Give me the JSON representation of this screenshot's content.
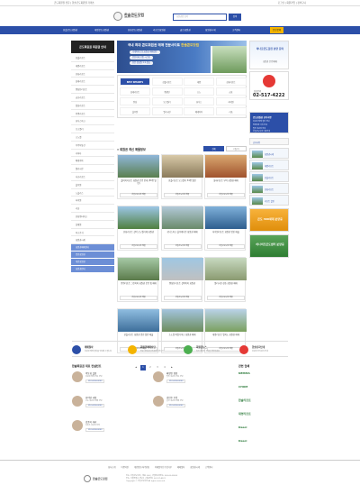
{
  "topbar": {
    "left": "콘도회원권 전문 | 한솔콘도회원권 거래소",
    "right": "로그인 | 회원가입 | 장바구니"
  },
  "header": {
    "logo_title": "한솔콘도닷컴",
    "logo_sub": "HANSOL CONDO",
    "search_placeholder": "회원권명 검색",
    "search_button": "검색"
  },
  "gnb": [
    "한솔콘도회원권",
    "대명콘도회원권",
    "한화콘도회원권",
    "리조트회원권",
    "골프회원권",
    "회원권시세",
    "고객센터"
  ],
  "gnb_highlight": "분양문의",
  "sidebar": {
    "title": "콘도회원권 회원권 안내",
    "items": [
      "한솔리조트",
      "대명리조트",
      "한화리조트",
      "롯데리조트",
      "켄싱턴리조트",
      "금호리조트",
      "일성리조트",
      "용평리조트",
      "휘닉스파크",
      "오크밸리",
      "소노벨",
      "무주덕유산",
      "라마다",
      "베네치아",
      "엘리시안",
      "사조리조트",
      "블루원",
      "노블리스",
      "하이원",
      "리솜",
      "한화워터파크",
      "설해원",
      "파크로쉬",
      "회원권시세"
    ],
    "blue_items": [
      "회원권매매안내",
      "법인회원권",
      "개인회원권",
      "회원권안내"
    ]
  },
  "banner": {
    "title": "국내 최대 콘도회원권 매매 전문사이트",
    "brand": "한솔콘도닷컴",
    "pills": [
      "국내최대 콘도회원권 매매전문",
      "안전거래 보장 시스템",
      "전문 상담원 1:1 상담"
    ]
  },
  "brands": [
    "BEST RESORTS",
    "한솔리조트",
    "대명",
    "한화리조트",
    "롯데리조트",
    "켄싱턴",
    "소노",
    "금호",
    "일성",
    "오크밸리",
    "휘닉스",
    "하이원",
    "블루원",
    "엘리시안",
    "베네치아",
    "리솜"
  ],
  "section": {
    "title": "회원권 최신 매물정보",
    "tab_on": "전체",
    "tab_off": "더보기"
  },
  "cards": [
    {
      "caption": "쏠비치리조트 회원권 분양 안내 (50평 일반)",
      "tag": "한솔콘도닷컴 매물"
    },
    {
      "caption": "한솔리조트 오크밸리 34평 일반",
      "tag": "한솔콘도닷컴 매물"
    },
    {
      "caption": "롯데리조트 부여 회원권 매매",
      "tag": "한솔콘도닷컴 매물"
    },
    {
      "caption": "한화리조트 설악 소노펠리체 회원권",
      "tag": "한솔콘도닷컴 매물"
    },
    {
      "caption": "휘닉스파크 블루캐니언 회원권 매매",
      "tag": "한솔콘도닷컴 매물"
    },
    {
      "caption": "하이원리조트 회원권 법인 매물",
      "tag": "한솔콘도닷컴 매물"
    },
    {
      "caption": "용평리조트 그린피아 회원권 분양 및 매매",
      "tag": "한솔콘도닷컴 매물"
    },
    {
      "caption": "켄싱턴리조트 설악비치 회원권",
      "tag": "한솔콘도닷컴 매물"
    },
    {
      "caption": "엘리시안 강촌 회원권 매매",
      "tag": "한솔콘도닷컴 매물"
    },
    {
      "caption": "한솔리조트 회원권 법인 일반 매물",
      "tag": "한솔콘도닷컴 매물"
    },
    {
      "caption": "소노벨 비발디파크 회원권 매매",
      "tag": "한솔콘도닷컴 매물"
    },
    {
      "caption": "대명리조트 델피노 회원권 매매",
      "tag": "한솔콘도닷컴 매물"
    }
  ],
  "pager": [
    "◀",
    "1",
    "2",
    "3",
    "4",
    "▶"
  ],
  "right": {
    "ad_title": "하나로콘도닷컴 분양 문의",
    "ad_sub": "회원권 분양/매매",
    "phone_label": "상담문의",
    "phone": "02-517-4222",
    "notice_title": "콘도회원권 공지사항",
    "notices": [
      "회원권 매매 절차 안내",
      "명의변경 서류 안내",
      "법인 회원권 안내",
      "한솔콘도닷컴 이용안내"
    ],
    "ads": [
      "회원권시세",
      "대명리조트",
      "한솔리조트",
      "한화리조트",
      "리조트 할인"
    ],
    "promo1": "콘도 300세대 분양중",
    "promo2": "하나비즈콘도센터 분양중",
    "info_title": "공지사항"
  },
  "features": [
    {
      "t": "매매절차",
      "s": "회원권 매매 절차를 안내해 드립니다",
      "c": "#2c4fa8"
    },
    {
      "t": "회원권매매상담",
      "s": "전문 상담원이 안내해 드립니다",
      "c": "#f4b400"
    },
    {
      "t": "회원권뉴스",
      "s": "최신 회원권 소식을 확인하세요",
      "c": "#4caf50"
    },
    {
      "t": "한솔유지안내",
      "s": "회원권 유지관리 안내",
      "c": "#e53935"
    }
  ],
  "consult": {
    "title": "한솔회원권 대표 컨설턴트",
    "people": [
      {
        "name": "박동희 실장",
        "desc": "회원권 매매 전문 상담",
        "phone": "010-0000-0000"
      },
      {
        "name": "황정민 팀장",
        "desc": "법인 회원권 전문 상담",
        "phone": "010-0000-0000"
      },
      {
        "name": "류이영 과장",
        "desc": "콘도 회원권 매매 상담",
        "phone": "010-0000-0000"
      },
      {
        "name": "김민주 주임",
        "desc": "골프 회원권 매매 상담",
        "phone": "010-0000-0000"
      },
      {
        "name": "김종미 대리",
        "desc": "리조트 회원권 상담",
        "phone": "010-0000-0000"
      }
    ]
  },
  "sites": {
    "title": "관련 업체",
    "items": [
      "NEMMA",
      "CHOM",
      "한솔리조트",
      "대명리조트",
      "Dasol",
      "Dasol"
    ]
  },
  "footer": {
    "nav": [
      "회사소개",
      "이용약관",
      "개인정보처리방침",
      "이메일무단수집거부",
      "매매절차",
      "회원권시세",
      "고객센터"
    ],
    "logo": "한솔콘도닷컴",
    "info": [
      "상호: 한솔콘도닷컴 | 대표: 000 | 사업자등록번호: 000-00-00000",
      "주소: 서울특별시 강남구 | 대표전화: 02-517-4222",
      "Copyright © 한솔콘도닷컴 All rights reserved."
    ]
  }
}
